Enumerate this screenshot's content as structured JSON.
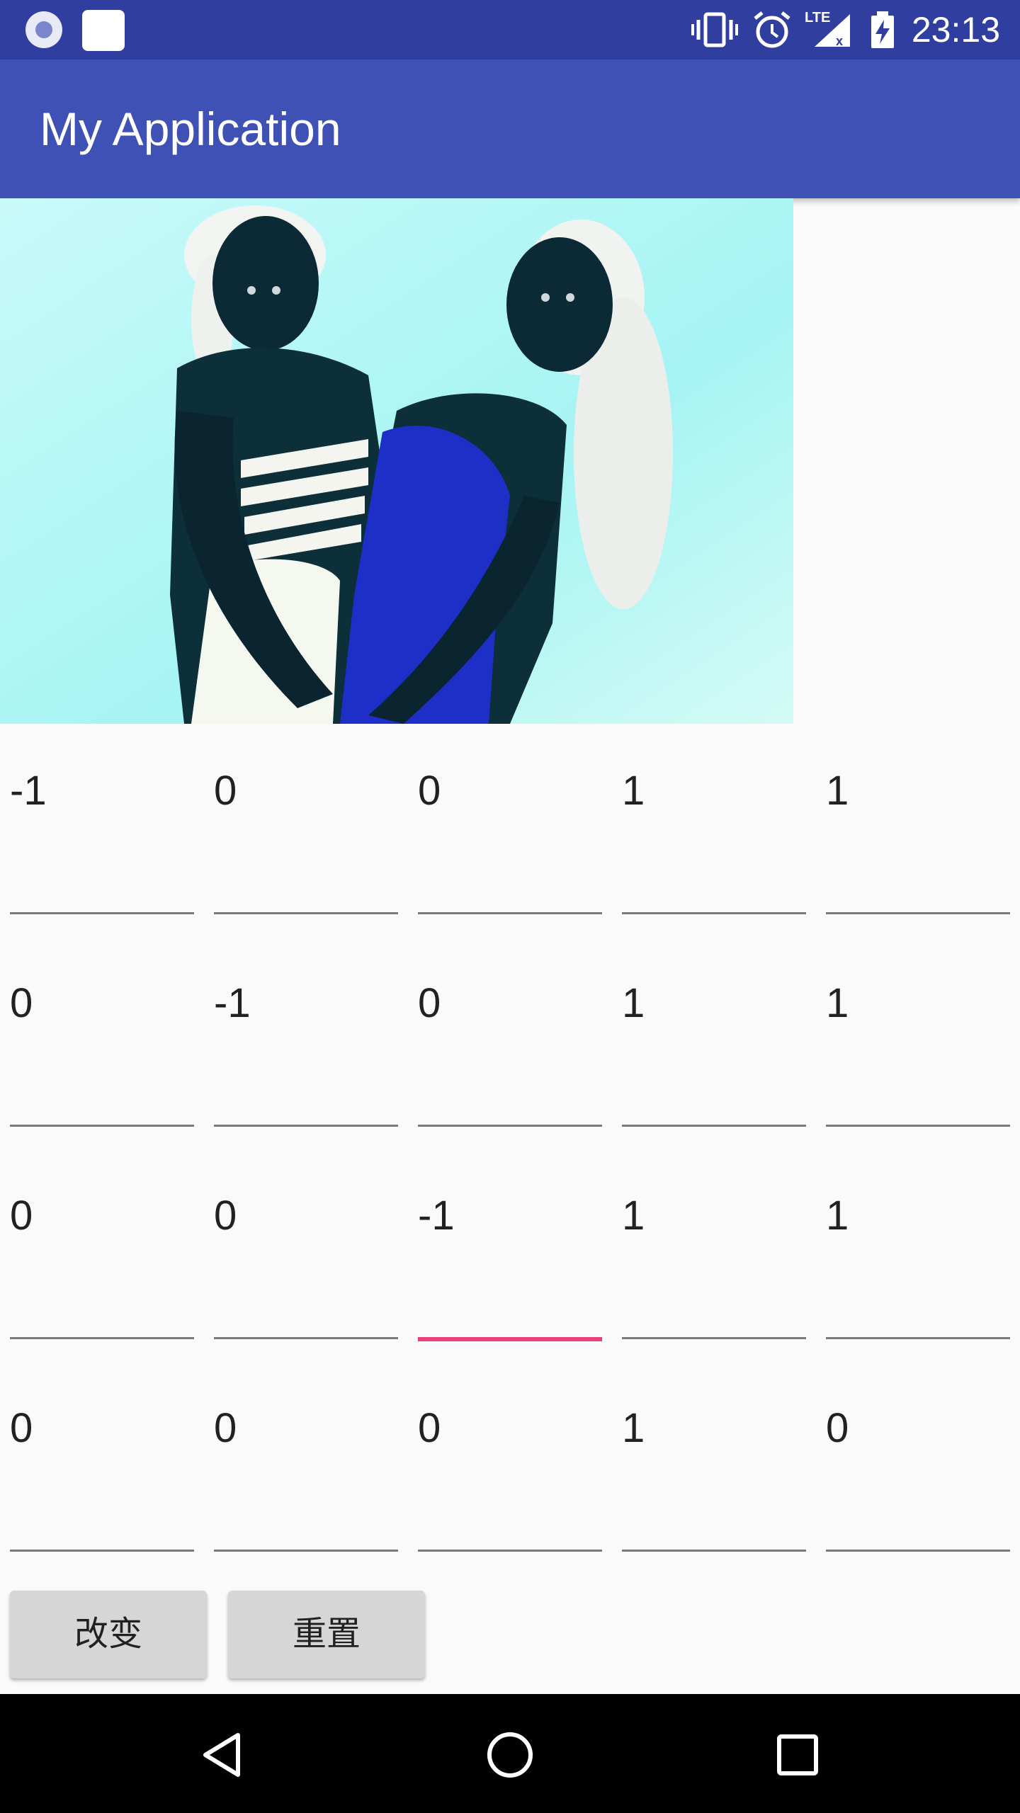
{
  "status_bar": {
    "time": "23:13",
    "lte_label": "LTE",
    "icons": [
      "media-icon",
      "notification-icon",
      "vibrate-icon",
      "alarm-icon",
      "signal-icon",
      "battery-charging-icon"
    ]
  },
  "app_bar": {
    "title": "My Application"
  },
  "image": {
    "description_icon": "photo-inverted"
  },
  "matrix": {
    "rows": [
      [
        "-1",
        "0",
        "0",
        "1",
        "1"
      ],
      [
        "0",
        "-1",
        "0",
        "1",
        "1"
      ],
      [
        "0",
        "0",
        "-1",
        "1",
        "1"
      ],
      [
        "0",
        "0",
        "0",
        "1",
        "0"
      ]
    ],
    "focused_row": 2,
    "focused_col": 2,
    "focus_color": "#ec407a"
  },
  "buttons": {
    "change_label": "改变",
    "reset_label": "重置"
  },
  "nav_bar": {
    "icons": [
      "back-icon",
      "home-icon",
      "recents-icon"
    ]
  },
  "colors": {
    "status_bar": "#303f9f",
    "app_bar": "#3f51b5",
    "accent": "#ec407a"
  }
}
